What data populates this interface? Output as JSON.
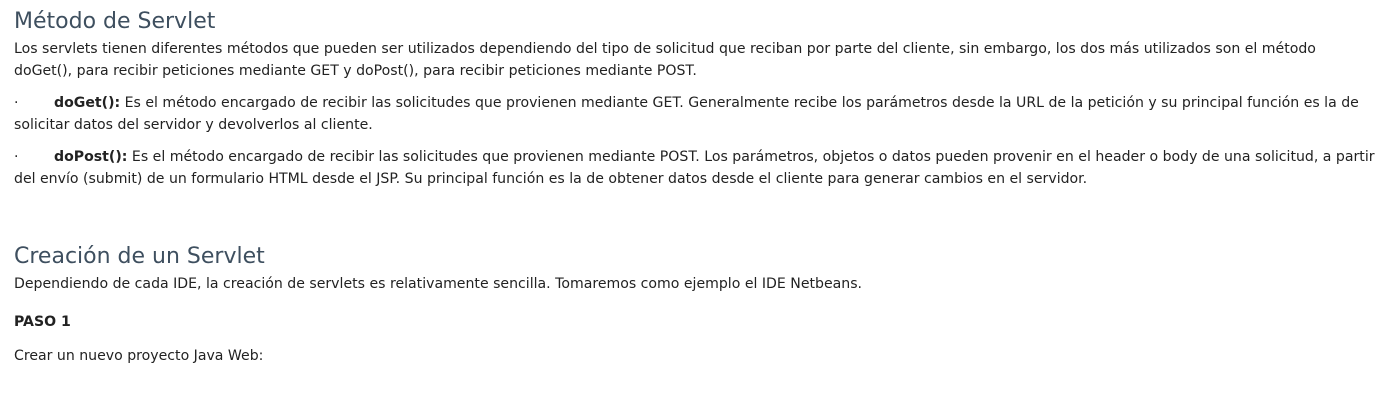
{
  "section1": {
    "title": "Método de Servlet",
    "intro": "Los servlets tienen diferentes métodos que pueden ser utilizados dependiendo del tipo de solicitud que reciban por parte del cliente, sin embargo, los dos más utilizados son el método doGet(), para recibir peticiones mediante GET y doPost(), para recibir peticiones mediante POST.",
    "bullets": [
      {
        "marker": "·",
        "term": "doGet():",
        "text": " Es el método encargado de recibir las solicitudes que provienen mediante GET. Generalmente recibe los parámetros desde la URL de la petición y su principal función es la de solicitar datos del servidor y devolverlos al cliente."
      },
      {
        "marker": "·",
        "term": "doPost():",
        "text": " Es el método encargado de recibir las solicitudes que provienen mediante POST. Los parámetros, objetos o datos pueden provenir en el header o body de una solicitud, a partir del envío (submit) de un formulario HTML desde el JSP. Su principal función es la de obtener datos desde el cliente para generar cambios en el servidor."
      }
    ]
  },
  "section2": {
    "title": "Creación de un Servlet",
    "intro": "Dependiendo de cada IDE, la creación de servlets es relativamente sencilla. Tomaremos como ejemplo el IDE Netbeans.",
    "step_label": "PASO 1",
    "step_text": "Crear un nuevo proyecto Java Web:"
  }
}
